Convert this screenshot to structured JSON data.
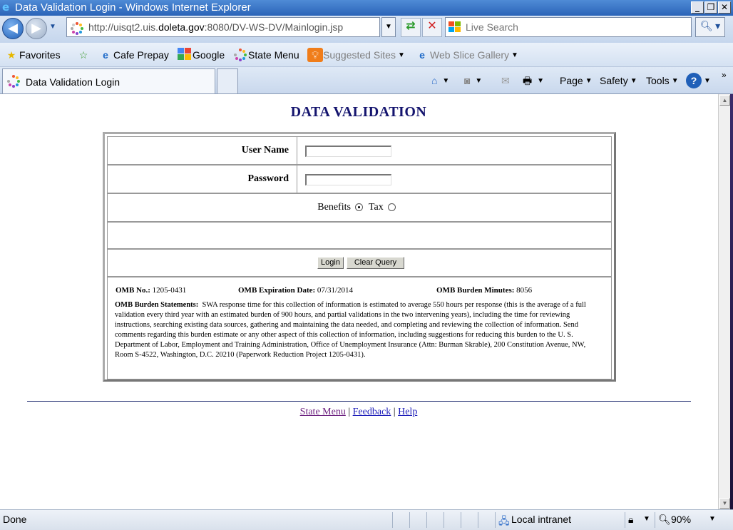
{
  "window": {
    "title": "Data Validation Login - Windows Internet Explorer",
    "minimize": "_",
    "restore": "❐",
    "close": "✕"
  },
  "addressbar": {
    "url_prefix": "http://uisqt2.uis.",
    "url_domain": "doleta.gov",
    "url_suffix": ":8080/DV-WS-DV/Mainlogin.jsp"
  },
  "search": {
    "placeholder": "Live Search"
  },
  "favorites_bar": {
    "favorites_label": "Favorites",
    "items": [
      "Cafe Prepay",
      "Google",
      "State Menu",
      "Suggested Sites",
      "Web Slice Gallery"
    ]
  },
  "tab": {
    "title": "Data Validation Login"
  },
  "command_bar": {
    "page": "Page",
    "safety": "Safety",
    "tools": "Tools"
  },
  "page": {
    "heading": "DATA VALIDATION",
    "username_label": "User Name",
    "password_label": "Password",
    "option_benefits": "Benefits",
    "option_tax": "Tax",
    "login_button": "Login",
    "clear_button": "Clear Query",
    "omb_no_label": "OMB No.:",
    "omb_no_value": "1205-0431",
    "omb_exp_label": "OMB Expiration Date:",
    "omb_exp_value": "07/31/2014",
    "omb_minutes_label": "OMB Burden Minutes:",
    "omb_minutes_value": "8056",
    "burden_label": "OMB Burden Statements:",
    "burden_text": "SWA response time for this collection of information is estimated to average 550 hours per response (this is the average of a full validation every third year with an estimated burden of 900 hours, and partial validations in the two intervening years), including the time for reviewing instructions, searching existing data sources, gathering and maintaining the data needed, and completing and reviewing the collection of information. Send comments regarding this burden estimate or any other aspect of this collection of information, including suggestions for reducing this burden to the U. S. Department of Labor, Employment and Training Administration, Office of Unemployment Insurance (Attn: Burman Skrable), 200 Constitution Avenue, NW, Room S-4522, Washington, D.C. 20210 (Paperwork Reduction Project 1205-0431).",
    "footer_links": [
      "State Menu",
      "Feedback",
      "Help"
    ],
    "separator": "|"
  },
  "statusbar": {
    "status": "Done",
    "zone": "Local intranet",
    "zoom": "90%"
  }
}
